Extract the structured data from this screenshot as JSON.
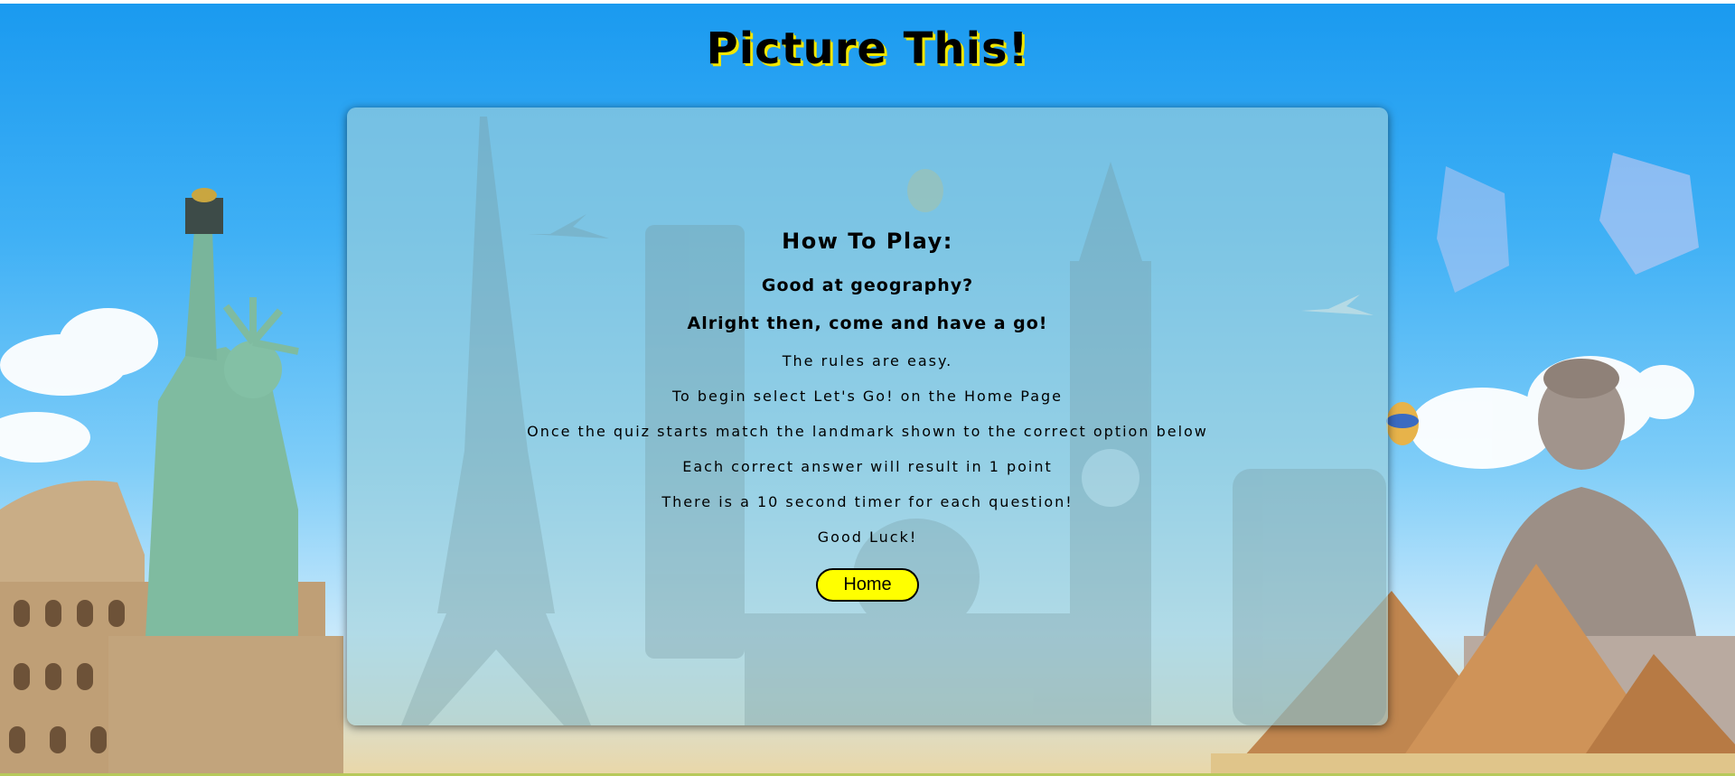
{
  "title": "Picture This!",
  "card": {
    "heading": "How To Play:",
    "subheading_1": "Good at geography?",
    "subheading_2": "Alright then, come and have a go!",
    "rules": [
      "The rules are easy.",
      "To begin select Let's Go! on the Home Page",
      "Once the quiz starts match the landmark shown to the correct option below",
      "Each correct answer will result in 1 point",
      "There is a 10 second timer for each question!",
      "Good Luck!"
    ],
    "home_button": "Home"
  },
  "colors": {
    "title_shadow": "#f2e600",
    "button_bg": "#ffff00",
    "card_tint": "#a3d2da"
  }
}
